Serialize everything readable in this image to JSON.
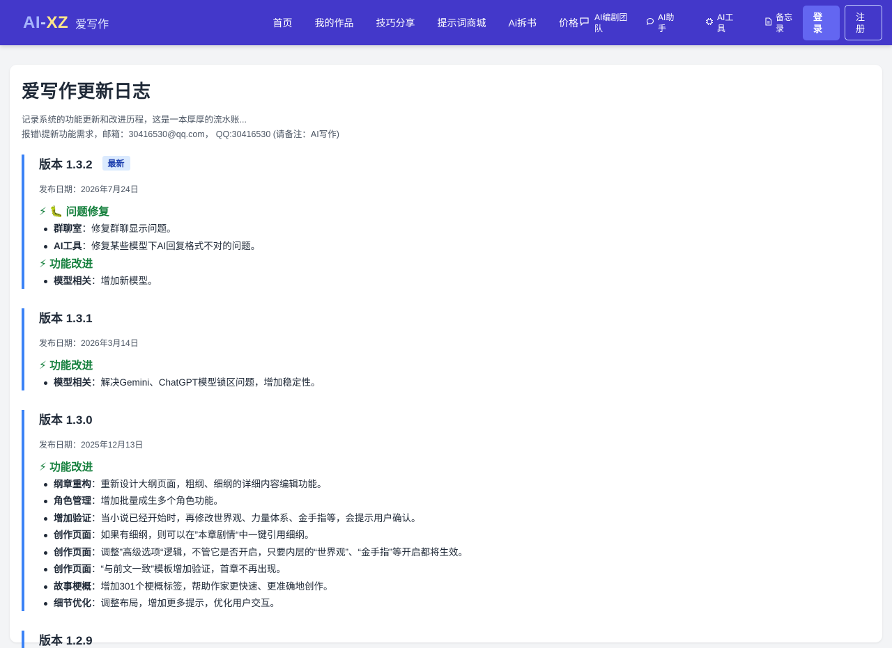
{
  "header": {
    "logo_ai": "AI",
    "logo_dash": "-",
    "logo_xz": "XZ",
    "logo_name": "爱写作",
    "nav": [
      "首页",
      "我的作品",
      "技巧分享",
      "提示词商城",
      "Ai拆书",
      "价格"
    ],
    "chat_icon": "chat-icon",
    "tools": [
      {
        "icon": "",
        "label": "AI编剧团队"
      },
      {
        "icon": "chat-bubble-icon",
        "label": "AI助手"
      },
      {
        "icon": "chip-icon",
        "label": "AI工具"
      },
      {
        "icon": "document-icon",
        "label": "备忘录"
      }
    ],
    "login": "登录",
    "register": "注册"
  },
  "page": {
    "title": "爱写作更新日志",
    "desc_line1": "记录系统的功能更新和改进历程，这是一本厚厚的流水账...",
    "desc_line2": "报错\\提新功能需求，邮箱：30416530@qq.com， QQ:30416530 (请备注：AI写作)"
  },
  "versions": [
    {
      "title": "版本 1.3.2",
      "badge": "最新",
      "date": "发布日期：2026年7月24日",
      "sections": [
        {
          "heading": "⚡ 🐛 问题修复",
          "items": [
            {
              "key": "群聊室",
              "text": "：修复群聊显示问题。"
            },
            {
              "key": "AI工具",
              "text": "：修复某些模型下AI回复格式不对的问题。"
            }
          ]
        },
        {
          "heading": "⚡ 功能改进",
          "items": [
            {
              "key": "模型相关",
              "text": "：增加新模型。"
            }
          ]
        }
      ]
    },
    {
      "title": "版本 1.3.1",
      "date": "发布日期：2026年3月14日",
      "sections": [
        {
          "heading": "⚡ 功能改进",
          "items": [
            {
              "key": "模型相关",
              "text": "：解决Gemini、ChatGPT模型锁区问题，增加稳定性。"
            }
          ]
        }
      ]
    },
    {
      "title": "版本 1.3.0",
      "date": "发布日期：2025年12月13日",
      "sections": [
        {
          "heading": "⚡ 功能改进",
          "items": [
            {
              "key": "纲章重构",
              "text": "：重新设计大纲页面，粗纲、细纲的详细内容编辑功能。"
            },
            {
              "key": "角色管理",
              "text": "：增加批量成生多个角色功能。"
            },
            {
              "key": "增加验证",
              "text": "：当小说已经开始时，再修改世界观、力量体系、金手指等，会提示用户确认。"
            },
            {
              "key": "创作页面",
              "text": "：如果有细纲，则可以在”本章剧情“中一键引用细纲。"
            },
            {
              "key": "创作页面",
              "text": "：调整”高级选项“逻辑，不管它是否开启，只要内层的“世界观”、“金手指”等开启都将生效。"
            },
            {
              "key": "创作页面",
              "text": "：“与前文一致”模板增加验证，首章不再出现。"
            },
            {
              "key": "故事梗概",
              "text": "：增加301个梗概标签，帮助作家更快速、更准确地创作。"
            },
            {
              "key": "细节优化",
              "text": "：调整布局，增加更多提示，优化用户交互。"
            }
          ]
        }
      ]
    },
    {
      "title": "版本 1.2.9"
    }
  ]
}
